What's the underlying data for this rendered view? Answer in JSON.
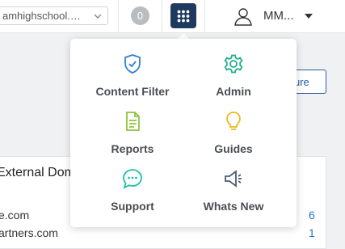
{
  "header": {
    "school_select_value": "amhighschool.…",
    "count_badge": "0",
    "user_name": "MM..."
  },
  "page": {
    "side_button_label": "ure",
    "panel_title": "External Dom",
    "rows": [
      {
        "domain": "e.com",
        "count": "6"
      },
      {
        "domain": "artners.com",
        "count": "1"
      }
    ]
  },
  "apps_menu": {
    "items": [
      {
        "label": "Content Filter",
        "icon": "shield-check-icon",
        "color": "#2f7fd6"
      },
      {
        "label": "Admin",
        "icon": "gear-icon",
        "color": "#1fae8f"
      },
      {
        "label": "Reports",
        "icon": "document-icon",
        "color": "#8cc63f"
      },
      {
        "label": "Guides",
        "icon": "lightbulb-icon",
        "color": "#f2b51c"
      },
      {
        "label": "Support",
        "icon": "chat-bubble-icon",
        "color": "#1fbfa6"
      },
      {
        "label": "Whats New",
        "icon": "megaphone-icon",
        "color": "#4c5a73"
      }
    ]
  }
}
